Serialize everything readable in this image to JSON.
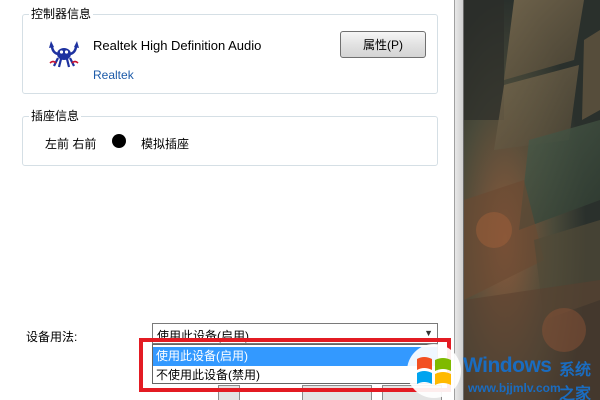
{
  "controller_info": {
    "title": "控制器信息",
    "device_name": "Realtek High Definition Audio",
    "vendor_link": "Realtek",
    "properties_button": "属性(P)",
    "logo_icon": "realtek-crab-icon"
  },
  "jack_info": {
    "title": "插座信息",
    "jacks": "左前 右前",
    "jack_type": "模拟插座",
    "jack_color": "#000000"
  },
  "device_usage": {
    "label": "设备用法:",
    "selected": "使用此设备(启用)",
    "options": [
      "使用此设备(启用)",
      "不使用此设备(禁用)"
    ],
    "highlight_color": "#e31b23"
  },
  "watermark": {
    "brand": "Windows",
    "text_cn": "系统之家",
    "url": "www.bjjmlv.com",
    "logo_icon": "windows-flag-icon"
  },
  "colors": {
    "link": "#1c5aa8",
    "selection": "#3399ff",
    "watermark": "#1a6cc0"
  }
}
